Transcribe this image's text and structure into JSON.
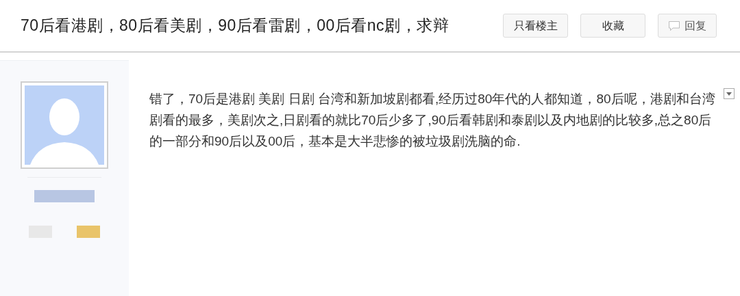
{
  "thread": {
    "title": "70后看港剧，80后看美剧，90后看雷剧，00后看nc剧，求辩"
  },
  "buttons": [
    {
      "label": "只看楼主",
      "kind": "plain"
    },
    {
      "label": "收藏",
      "kind": "plain"
    },
    {
      "label": "回复",
      "kind": "reply"
    }
  ],
  "post": {
    "content": "错了，70后是港剧 美剧 日剧 台湾和新加坡剧都看,经历过80年代的人都知道，80后呢，港剧和台湾剧看的最多，美剧次之,日剧看的就比70后少多了,90后看韩剧和泰剧以及内地剧的比较多,总之80后的一部分和90后以及00后，基本是大半悲惨的被垃圾剧洗脑的命."
  }
}
